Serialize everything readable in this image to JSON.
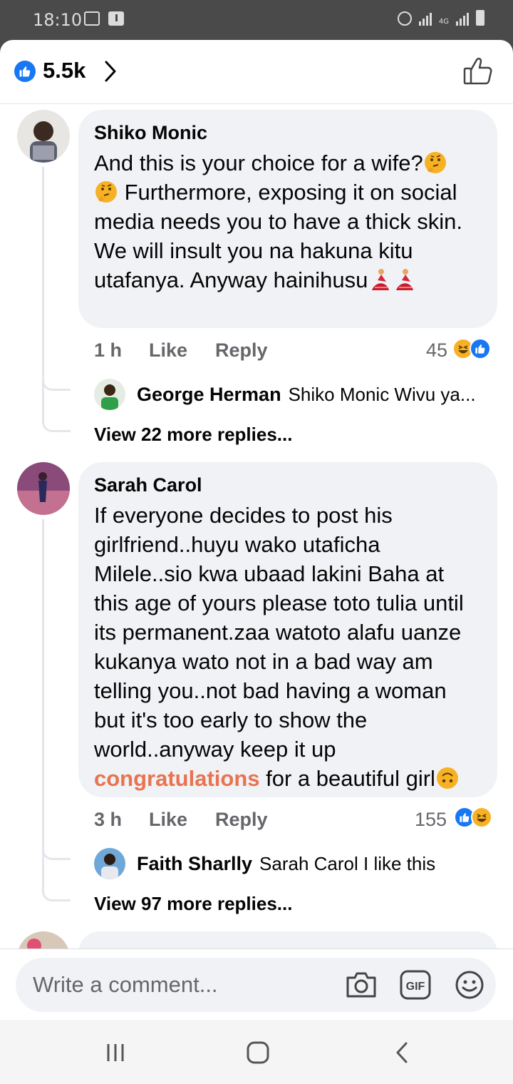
{
  "status_bar": {
    "time": "18:10",
    "network": "4G"
  },
  "header": {
    "reaction_count": "5.5k"
  },
  "comments": [
    {
      "author": "Shiko Monic",
      "text_line1": "And this is your choice for a wife?",
      "text_line2": " Furthermore, exposing it on social media needs you to have a thick skin. We will insult you na hakuna kitu utafanya. Anyway hainihusu",
      "time": "1 h",
      "like_label": "Like",
      "reply_label": "Reply",
      "reaction_count": "45",
      "reply_preview": {
        "author": "George Herman",
        "text": "Shiko Monic Wivu ya..."
      },
      "view_more": "View 22 more replies..."
    },
    {
      "author": "Sarah Carol",
      "text_main": "If everyone decides to post his girlfriend..huyu wako utaficha Milele..sio kwa ubaad lakini Baha at this age of yours please toto tulia until its permanent.zaa watoto alafu uanze kukanya wato not in a bad way am telling you..not bad having a woman but it's too early to show the world..anyway keep it up ",
      "text_highlight": "congratulations",
      "text_end": " for a beautiful girl",
      "time": "3 h",
      "like_label": "Like",
      "reply_label": "Reply",
      "reaction_count": "155",
      "reply_preview": {
        "author": "Faith Sharlly",
        "text": "Sarah Carol I like this"
      },
      "view_more": "View 97 more replies..."
    }
  ],
  "composer": {
    "placeholder": "Write a comment..."
  },
  "colors": {
    "facebook_blue": "#1877f2",
    "highlight": "#e9734f",
    "bubble": "#f0f2f5"
  },
  "icons": [
    "like-reaction-icon",
    "haha-reaction-icon",
    "thumbs-up-icon",
    "camera-icon",
    "gif-icon",
    "emoji-icon",
    "thinking-emoji",
    "dancer-emoji",
    "upside-down-face-emoji"
  ]
}
